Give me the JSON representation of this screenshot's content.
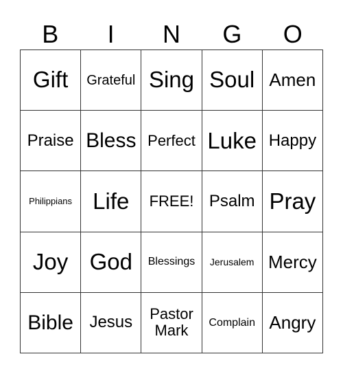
{
  "header": [
    "B",
    "I",
    "N",
    "G",
    "O"
  ],
  "cells": [
    [
      "Gift",
      "Grateful",
      "Sing",
      "Soul",
      "Amen"
    ],
    [
      "Praise",
      "Bless",
      "Perfect",
      "Luke",
      "Happy"
    ],
    [
      "Philippians",
      "Life",
      "FREE!",
      "Psalm",
      "Pray"
    ],
    [
      "Joy",
      "God",
      "Blessings",
      "Jerusalem",
      "Mercy"
    ],
    [
      "Bible",
      "Jesus",
      "Pastor Mark",
      "Complain",
      "Angry"
    ]
  ],
  "colors": {
    "border": "#333333",
    "background": "#ffffff",
    "text": "#000000"
  }
}
